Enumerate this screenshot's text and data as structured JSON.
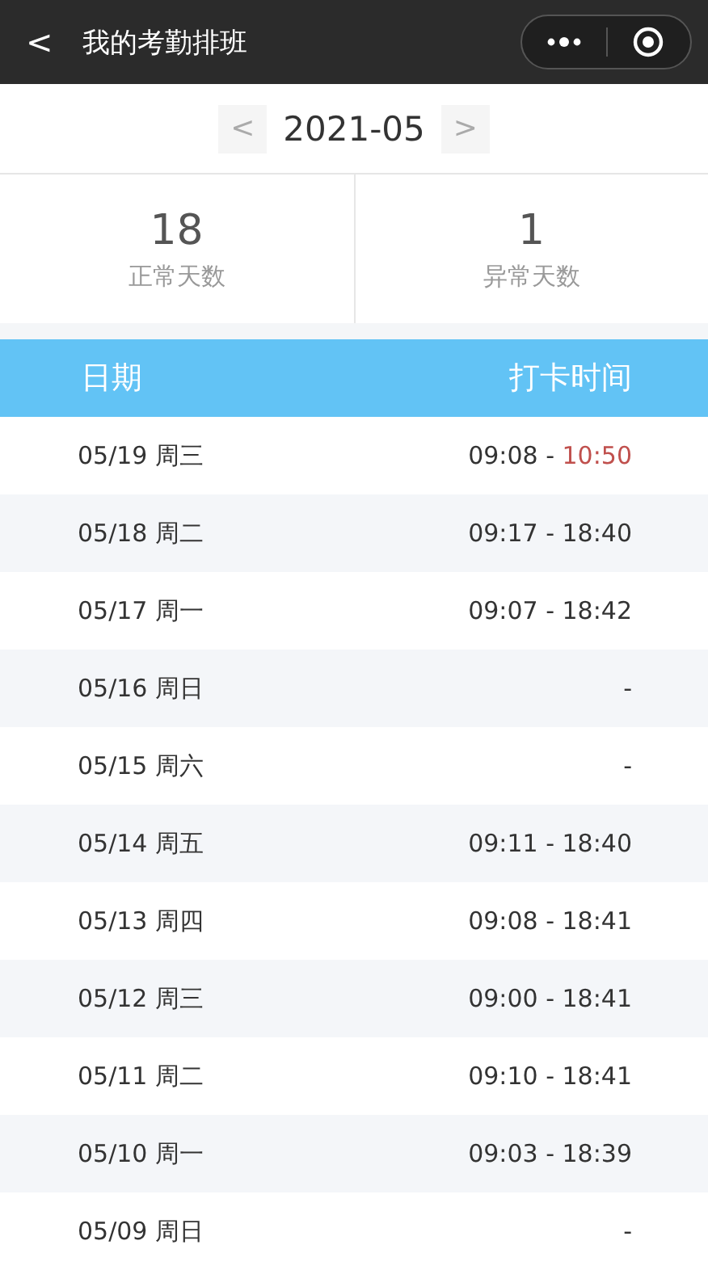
{
  "nav_bar": {
    "back_glyph": "<",
    "title": "我的考勤排班"
  },
  "month_picker": {
    "prev": "<",
    "month": "2021-05",
    "next": ">"
  },
  "stats": [
    {
      "value": "18",
      "label": "正常天数"
    },
    {
      "value": "1",
      "label": "异常天数"
    }
  ],
  "table": {
    "columns": [
      "日期",
      "打卡时间"
    ],
    "rows": [
      {
        "date": "05/19 周三",
        "kind": "punched",
        "start": "09:08",
        "separator": " - ",
        "end": "10:50",
        "end_abnormal": true
      },
      {
        "date": "05/18 周二",
        "kind": "punched",
        "start": "09:17",
        "separator": " - ",
        "end": "18:40",
        "end_abnormal": false
      },
      {
        "date": "05/17 周一",
        "kind": "punched",
        "start": "09:07",
        "separator": " - ",
        "end": "18:42",
        "end_abnormal": false
      },
      {
        "date": "05/16 周日",
        "kind": "empty",
        "text": "-"
      },
      {
        "date": "05/15 周六",
        "kind": "empty",
        "text": "-"
      },
      {
        "date": "05/14 周五",
        "kind": "punched",
        "start": "09:11",
        "separator": " - ",
        "end": "18:40",
        "end_abnormal": false
      },
      {
        "date": "05/13 周四",
        "kind": "punched",
        "start": "09:08",
        "separator": " - ",
        "end": "18:41",
        "end_abnormal": false
      },
      {
        "date": "05/12 周三",
        "kind": "punched",
        "start": "09:00",
        "separator": " - ",
        "end": "18:41",
        "end_abnormal": false
      },
      {
        "date": "05/11 周二",
        "kind": "punched",
        "start": "09:10",
        "separator": " - ",
        "end": "18:41",
        "end_abnormal": false
      },
      {
        "date": "05/10 周一",
        "kind": "punched",
        "start": "09:03",
        "separator": " - ",
        "end": "18:39",
        "end_abnormal": false
      },
      {
        "date": "05/09 周日",
        "kind": "empty",
        "text": "-"
      }
    ]
  }
}
